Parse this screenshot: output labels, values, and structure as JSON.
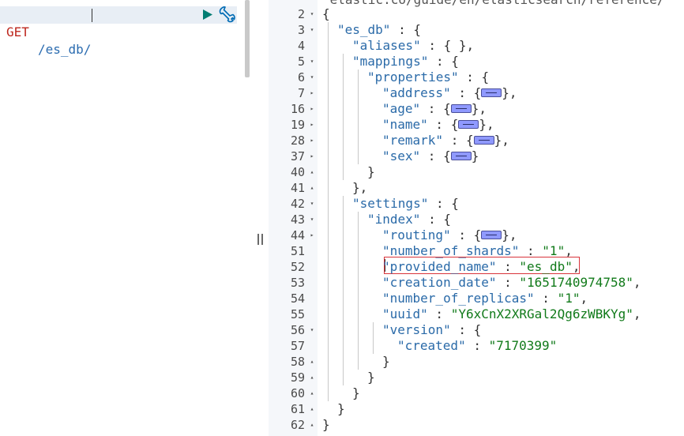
{
  "request": {
    "method": "GET",
    "url": "/es_db/"
  },
  "icons": {
    "run": "play-icon",
    "wrench": "wrench-icon",
    "resize": "resize-handle-icon"
  },
  "colors": {
    "method": "#bd271e",
    "url": "#2b6cb0",
    "key": "#2a6aa8",
    "string": "#117a1a",
    "highlight": "#d9343b"
  },
  "partial_top_text": "\"elastic.co/guide/en/elasticsearch/reference/",
  "lines": [
    {
      "num": "2",
      "fold": "down",
      "indent": 0,
      "parts": [
        {
          "t": "p",
          "v": "{"
        }
      ]
    },
    {
      "num": "3",
      "fold": "down",
      "indent": 1,
      "parts": [
        {
          "t": "k",
          "v": "\"es_db\""
        },
        {
          "t": "p",
          "v": " : {"
        }
      ]
    },
    {
      "num": "4",
      "fold": "",
      "indent": 2,
      "parts": [
        {
          "t": "k",
          "v": "\"aliases\""
        },
        {
          "t": "p",
          "v": " : { },"
        }
      ]
    },
    {
      "num": "5",
      "fold": "down",
      "indent": 2,
      "parts": [
        {
          "t": "k",
          "v": "\"mappings\""
        },
        {
          "t": "p",
          "v": " : {"
        }
      ]
    },
    {
      "num": "6",
      "fold": "down",
      "indent": 3,
      "parts": [
        {
          "t": "k",
          "v": "\"properties\""
        },
        {
          "t": "p",
          "v": " : {"
        }
      ]
    },
    {
      "num": "7",
      "fold": "right",
      "indent": 4,
      "parts": [
        {
          "t": "k",
          "v": "\"address\""
        },
        {
          "t": "p",
          "v": " : {"
        },
        {
          "t": "c"
        },
        {
          "t": "p",
          "v": "},"
        }
      ]
    },
    {
      "num": "16",
      "fold": "right",
      "indent": 4,
      "parts": [
        {
          "t": "k",
          "v": "\"age\""
        },
        {
          "t": "p",
          "v": " : {"
        },
        {
          "t": "c"
        },
        {
          "t": "p",
          "v": "},"
        }
      ]
    },
    {
      "num": "19",
      "fold": "right",
      "indent": 4,
      "parts": [
        {
          "t": "k",
          "v": "\"name\""
        },
        {
          "t": "p",
          "v": " : {"
        },
        {
          "t": "c"
        },
        {
          "t": "p",
          "v": "},"
        }
      ]
    },
    {
      "num": "28",
      "fold": "right",
      "indent": 4,
      "parts": [
        {
          "t": "k",
          "v": "\"remark\""
        },
        {
          "t": "p",
          "v": " : {"
        },
        {
          "t": "c"
        },
        {
          "t": "p",
          "v": "},"
        }
      ]
    },
    {
      "num": "37",
      "fold": "right",
      "indent": 4,
      "parts": [
        {
          "t": "k",
          "v": "\"sex\""
        },
        {
          "t": "p",
          "v": " : {"
        },
        {
          "t": "c"
        },
        {
          "t": "p",
          "v": "}"
        }
      ]
    },
    {
      "num": "40",
      "fold": "up",
      "indent": 3,
      "parts": [
        {
          "t": "p",
          "v": "}"
        }
      ]
    },
    {
      "num": "41",
      "fold": "up",
      "indent": 2,
      "parts": [
        {
          "t": "p",
          "v": "},"
        }
      ]
    },
    {
      "num": "42",
      "fold": "down",
      "indent": 2,
      "parts": [
        {
          "t": "k",
          "v": "\"settings\""
        },
        {
          "t": "p",
          "v": " : {"
        }
      ]
    },
    {
      "num": "43",
      "fold": "down",
      "indent": 3,
      "parts": [
        {
          "t": "k",
          "v": "\"index\""
        },
        {
          "t": "p",
          "v": " : {"
        }
      ]
    },
    {
      "num": "44",
      "fold": "right",
      "indent": 4,
      "parts": [
        {
          "t": "k",
          "v": "\"routing\""
        },
        {
          "t": "p",
          "v": " : {"
        },
        {
          "t": "c"
        },
        {
          "t": "p",
          "v": "},"
        }
      ]
    },
    {
      "num": "51",
      "fold": "",
      "indent": 4,
      "parts": [
        {
          "t": "k",
          "v": "\"number_of_shards\""
        },
        {
          "t": "p",
          "v": " : "
        },
        {
          "t": "s",
          "v": "\"1\""
        },
        {
          "t": "p",
          "v": ","
        }
      ]
    },
    {
      "num": "52",
      "fold": "",
      "indent": 4,
      "parts": [
        {
          "t": "k",
          "v": "\"provided_name\""
        },
        {
          "t": "p",
          "v": " : "
        },
        {
          "t": "s",
          "v": "\"es_db\""
        },
        {
          "t": "p",
          "v": ","
        }
      ]
    },
    {
      "num": "53",
      "fold": "",
      "indent": 4,
      "parts": [
        {
          "t": "k",
          "v": "\"creation_date\""
        },
        {
          "t": "p",
          "v": " : "
        },
        {
          "t": "s",
          "v": "\"1651740974758\""
        },
        {
          "t": "p",
          "v": ","
        }
      ]
    },
    {
      "num": "54",
      "fold": "",
      "indent": 4,
      "parts": [
        {
          "t": "k",
          "v": "\"number_of_replicas\""
        },
        {
          "t": "p",
          "v": " : "
        },
        {
          "t": "s",
          "v": "\"1\""
        },
        {
          "t": "p",
          "v": ","
        }
      ]
    },
    {
      "num": "55",
      "fold": "",
      "indent": 4,
      "parts": [
        {
          "t": "k",
          "v": "\"uuid\""
        },
        {
          "t": "p",
          "v": " : "
        },
        {
          "t": "s",
          "v": "\"Y6xCnX2XRGal2Qg6zWBKYg\""
        },
        {
          "t": "p",
          "v": ","
        }
      ]
    },
    {
      "num": "56",
      "fold": "down",
      "indent": 4,
      "parts": [
        {
          "t": "k",
          "v": "\"version\""
        },
        {
          "t": "p",
          "v": " : {"
        }
      ]
    },
    {
      "num": "57",
      "fold": "",
      "indent": 5,
      "parts": [
        {
          "t": "k",
          "v": "\"created\""
        },
        {
          "t": "p",
          "v": " : "
        },
        {
          "t": "s",
          "v": "\"7170399\""
        }
      ]
    },
    {
      "num": "58",
      "fold": "up",
      "indent": 4,
      "parts": [
        {
          "t": "p",
          "v": "}"
        }
      ]
    },
    {
      "num": "59",
      "fold": "up",
      "indent": 3,
      "parts": [
        {
          "t": "p",
          "v": "}"
        }
      ]
    },
    {
      "num": "60",
      "fold": "up",
      "indent": 2,
      "parts": [
        {
          "t": "p",
          "v": "}"
        }
      ]
    },
    {
      "num": "61",
      "fold": "up",
      "indent": 1,
      "parts": [
        {
          "t": "p",
          "v": "}"
        }
      ]
    },
    {
      "num": "62",
      "fold": "up",
      "indent": 0,
      "parts": [
        {
          "t": "p",
          "v": "}"
        }
      ]
    }
  ]
}
